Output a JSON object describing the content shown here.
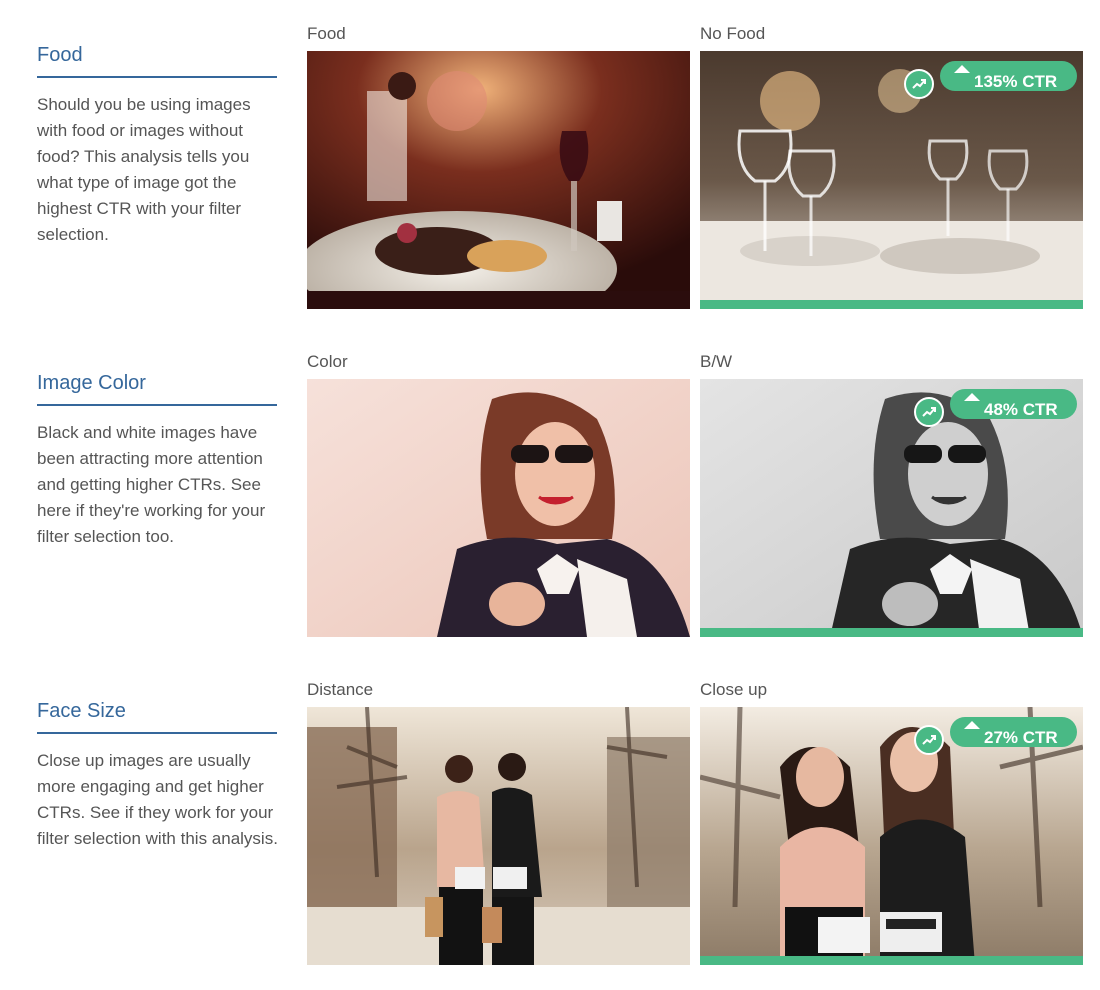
{
  "sections": [
    {
      "title": "Food",
      "description": "Should you be using images with food or images without food? This analysis tells you what type of image got the highest CTR with your filter selection.",
      "left_caption": "Food",
      "right_caption": "No Food",
      "badge": "135% CTR"
    },
    {
      "title": "Image Color",
      "description": "Black and white images have been attracting more attention and getting higher CTRs. See here if they're working for your filter selection too.",
      "left_caption": "Color",
      "right_caption": "B/W",
      "badge": "48% CTR"
    },
    {
      "title": "Face Size",
      "description": "Close up images are usually more engaging and get higher CTRs. See if they work for your filter selection with this analysis.",
      "left_caption": "Distance",
      "right_caption": "Close up",
      "badge": "27% CTR"
    }
  ],
  "colors": {
    "accent": "#35679b",
    "winner": "#49b985"
  },
  "icons": {
    "badge": "trending-up-icon",
    "pill": "up-triangle-icon"
  }
}
